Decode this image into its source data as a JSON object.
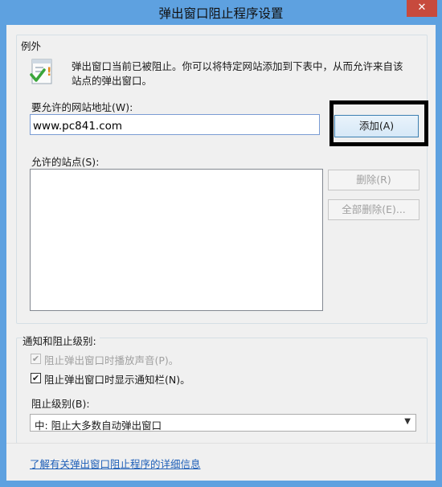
{
  "window": {
    "title": "弹出窗口阻止程序设置",
    "close_glyph": "✕"
  },
  "exceptions": {
    "group_title": "例外",
    "info_text_line1": "弹出窗口当前已被阻止。你可以将特定网站添加到下表中，从而允许来自该",
    "info_text_line2": "站点的弹出窗口。",
    "address_label": "要允许的网站地址(W):",
    "address_value": "www.pc841.com",
    "add_button": "添加(A)",
    "allowed_label": "允许的站点(S):",
    "allowed_sites": [],
    "remove_button": "删除(R)",
    "remove_all_button": "全部删除(E)..."
  },
  "notifications": {
    "group_title": "通知和阻止级别:",
    "play_sound_label": "阻止弹出窗口时播放声音(P)。",
    "play_sound_checked": true,
    "play_sound_disabled": true,
    "show_bar_label": "阻止弹出窗口时显示通知栏(N)。",
    "show_bar_checked": true,
    "level_label": "阻止级别(B):",
    "level_value": "中: 阻止大多数自动弹出窗口"
  },
  "footer": {
    "learn_more_link": "了解有关弹出窗口阻止程序的详细信息"
  },
  "icons": {
    "info_icon": "warning-shield-icon",
    "checkmark": "✔",
    "dropdown": "▼"
  },
  "colors": {
    "titlebar": "#5ea1e0",
    "close_button": "#c74a3d",
    "link": "#1e5fb8"
  }
}
